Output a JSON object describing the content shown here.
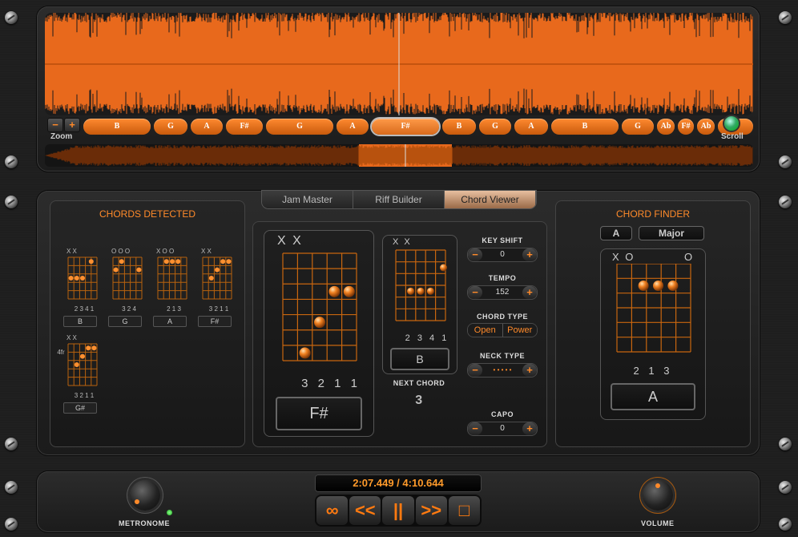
{
  "waveform": {
    "zoom_label": "Zoom",
    "zoom_out": "−",
    "zoom_in": "+",
    "scroll_label": "Scroll",
    "chords": [
      {
        "label": "B"
      },
      {
        "label": "G"
      },
      {
        "label": "A"
      },
      {
        "label": "F#"
      },
      {
        "label": "G"
      },
      {
        "label": "A"
      },
      {
        "label": "F#",
        "active": true
      },
      {
        "label": "B"
      },
      {
        "label": "G"
      },
      {
        "label": "A"
      },
      {
        "label": "B"
      },
      {
        "label": "G"
      },
      {
        "label": "Ab"
      },
      {
        "label": "F#"
      },
      {
        "label": "Ab"
      },
      {
        "label": ""
      }
    ]
  },
  "tabs": [
    {
      "label": "Jam Master"
    },
    {
      "label": "Riff Builder"
    },
    {
      "label": "Chord Viewer",
      "active": true
    }
  ],
  "chords_detected": {
    "title": "CHORDS DETECTED",
    "items": [
      {
        "name": "B",
        "top": "X X",
        "fingers": "2 3 4 1"
      },
      {
        "name": "G",
        "top": "O O O",
        "fingers": "3 2    4"
      },
      {
        "name": "A",
        "top": "X O      O",
        "fingers": "2 1 3"
      },
      {
        "name": "F#",
        "top": "X X",
        "fingers": "3 2 1 1"
      },
      {
        "name": "G#",
        "top": "X X",
        "fingers": "3 2 1 1",
        "fret": "4fr"
      }
    ]
  },
  "current_chord": {
    "name": "F#",
    "mutes": "X X",
    "fingers": "3 2 1 1"
  },
  "next_chord": {
    "name": "B",
    "mutes": "X X",
    "fingers": "2 3 4 1",
    "label": "NEXT CHORD",
    "countdown": "3"
  },
  "controls": {
    "key_shift": {
      "label": "KEY SHIFT",
      "value": "0"
    },
    "tempo": {
      "label": "TEMPO",
      "value": "152"
    },
    "chord_type": {
      "label": "CHORD TYPE",
      "options": [
        "Open",
        "Power"
      ]
    },
    "neck_type": {
      "label": "NECK TYPE",
      "value": "• • • • •"
    },
    "capo": {
      "label": "CAPO",
      "value": "0"
    },
    "minus": "−",
    "plus": "+"
  },
  "chord_finder": {
    "title": "CHORD FINDER",
    "root": "A",
    "quality": "Major",
    "mutes": "X O",
    "open_end": "O",
    "fingers": "2 1 3",
    "name": "A"
  },
  "transport": {
    "time": "2:07.449 / 4:10.644",
    "buttons": [
      "∞",
      "<<",
      "||",
      ">>",
      "□"
    ],
    "metronome_label": "METRONOME",
    "volume_label": "VOLUME"
  },
  "colors": {
    "accent": "#ff8a2a",
    "wave": "#e8691c"
  }
}
